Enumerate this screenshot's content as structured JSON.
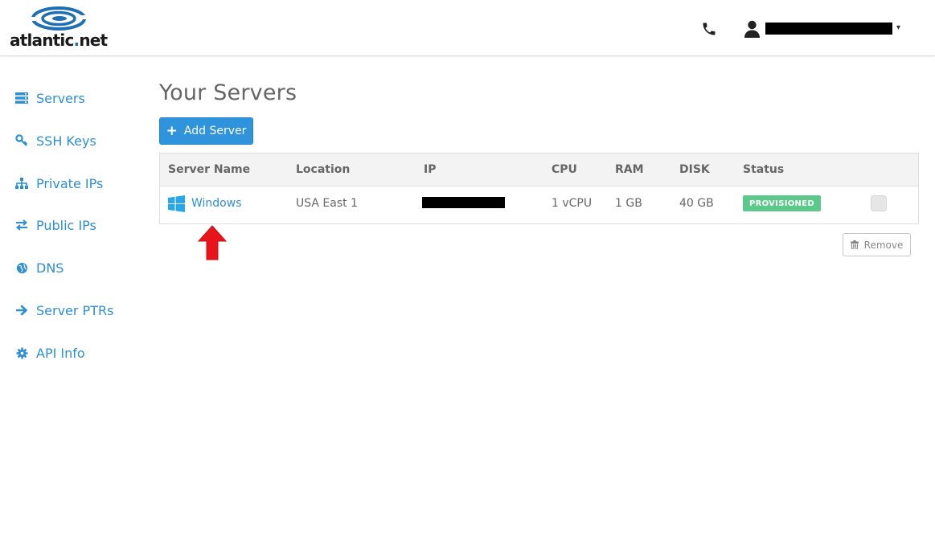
{
  "header": {
    "logo_text_main": "atlantic",
    "logo_text_dot": ".",
    "logo_text_tld": "net",
    "phone_icon": "phone-icon",
    "user_icon": "user-icon",
    "user_menu_caret": "▾"
  },
  "sidebar": {
    "items": [
      {
        "label": "Servers",
        "icon": "server-icon"
      },
      {
        "label": "SSH Keys",
        "icon": "key-icon"
      },
      {
        "label": "Private IPs",
        "icon": "sitemap-icon"
      },
      {
        "label": "Public IPs",
        "icon": "exchange-icon"
      },
      {
        "label": "DNS",
        "icon": "globe-icon"
      },
      {
        "label": "Server PTRs",
        "icon": "arrow-right-icon"
      },
      {
        "label": "API Info",
        "icon": "gear-icon"
      }
    ]
  },
  "main": {
    "title": "Your Servers",
    "add_button_label": "Add Server",
    "table": {
      "headers": [
        "Server Name",
        "Location",
        "IP",
        "CPU",
        "RAM",
        "DISK",
        "Status"
      ],
      "rows": [
        {
          "name": "Windows",
          "location": "USA East 1",
          "ip": "",
          "cpu": "1 vCPU",
          "ram": "1 GB",
          "disk": "40 GB",
          "status": "PROVISIONED"
        }
      ]
    },
    "remove_button_label": "Remove"
  },
  "colors": {
    "accent": "#2f94db",
    "link": "#2d8fd5",
    "status_ok": "#5cc98a",
    "annotation_arrow": "#e8131b"
  }
}
